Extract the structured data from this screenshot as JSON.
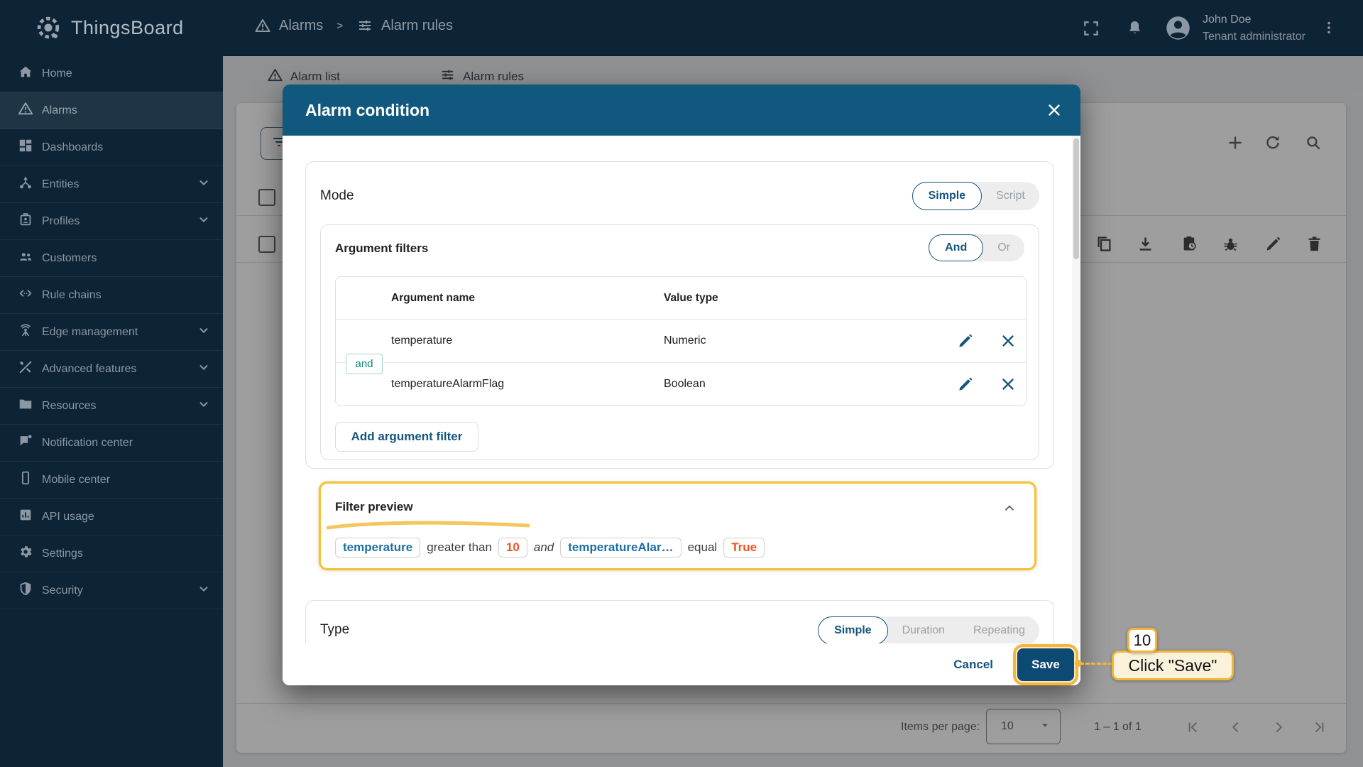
{
  "header": {
    "app_title": "ThingsBoard",
    "breadcrumb": {
      "section": "Alarms",
      "separator": ">",
      "page": "Alarm rules"
    },
    "user": {
      "name": "John Doe",
      "role": "Tenant administrator"
    }
  },
  "sidebar": {
    "items": [
      {
        "label": "Home",
        "icon": "home-icon",
        "expandable": false,
        "active": false
      },
      {
        "label": "Alarms",
        "icon": "warning-icon",
        "expandable": false,
        "active": true
      },
      {
        "label": "Dashboards",
        "icon": "dashboards-icon",
        "expandable": false,
        "active": false
      },
      {
        "label": "Entities",
        "icon": "entities-icon",
        "expandable": true,
        "active": false
      },
      {
        "label": "Profiles",
        "icon": "profiles-icon",
        "expandable": true,
        "active": false
      },
      {
        "label": "Customers",
        "icon": "customers-icon",
        "expandable": false,
        "active": false
      },
      {
        "label": "Rule chains",
        "icon": "rule-chains-icon",
        "expandable": false,
        "active": false
      },
      {
        "label": "Edge management",
        "icon": "edge-icon",
        "expandable": true,
        "active": false
      },
      {
        "label": "Advanced features",
        "icon": "tools-icon",
        "expandable": true,
        "active": false
      },
      {
        "label": "Resources",
        "icon": "folder-icon",
        "expandable": true,
        "active": false
      },
      {
        "label": "Notification center",
        "icon": "notification-icon",
        "expandable": false,
        "active": false
      },
      {
        "label": "Mobile center",
        "icon": "mobile-icon",
        "expandable": false,
        "active": false
      },
      {
        "label": "API usage",
        "icon": "api-usage-icon",
        "expandable": false,
        "active": false
      },
      {
        "label": "Settings",
        "icon": "gear-icon",
        "expandable": false,
        "active": false
      },
      {
        "label": "Security",
        "icon": "shield-icon",
        "expandable": true,
        "active": false
      }
    ]
  },
  "background": {
    "tabs": [
      {
        "label": "Alarm list"
      },
      {
        "label": "Alarm rules"
      }
    ],
    "toolbar_icons": [
      "filter",
      "add",
      "refresh",
      "search"
    ],
    "row_action_icons": [
      "copy",
      "download",
      "events",
      "debug",
      "edit",
      "delete"
    ],
    "pagination": {
      "items_per_page_label": "Items per page:",
      "items_per_page_value": "10",
      "range_label": "1 – 1 of 1"
    }
  },
  "modal": {
    "title": "Alarm condition",
    "mode": {
      "label": "Mode",
      "options": [
        "Simple",
        "Script"
      ],
      "selected": "Simple"
    },
    "argument_filters": {
      "title": "Argument filters",
      "operator_options": [
        "And",
        "Or"
      ],
      "operator_selected": "And",
      "table": {
        "columns": [
          "Argument name",
          "Value type"
        ],
        "rows": [
          {
            "argument_name": "temperature",
            "value_type": "Numeric"
          },
          {
            "argument_name": "temperatureAlarmFlag",
            "value_type": "Boolean"
          }
        ],
        "row_join_label": "and"
      },
      "add_button_label": "Add argument filter"
    },
    "filter_preview": {
      "title": "Filter preview",
      "expression": [
        {
          "type": "chip-blue",
          "text": "temperature"
        },
        {
          "type": "text",
          "text": "greater than"
        },
        {
          "type": "chip-orange",
          "text": "10"
        },
        {
          "type": "italic",
          "text": "and"
        },
        {
          "type": "chip-blue",
          "text": "temperatureAlar…"
        },
        {
          "type": "text",
          "text": "equal"
        },
        {
          "type": "chip-orange",
          "text": "True"
        }
      ]
    },
    "type_section": {
      "label": "Type",
      "options": [
        "Simple",
        "Duration",
        "Repeating"
      ],
      "selected": "Simple"
    },
    "footer": {
      "cancel_label": "Cancel",
      "save_label": "Save"
    }
  },
  "annotation": {
    "step_number": "10",
    "instruction": "Click \"Save\""
  },
  "colors": {
    "sidebar_navy": "#0d2336",
    "modal_header_blue": "#11587e",
    "primary_blue": "#14557c",
    "save_button_blue": "#0d4a73",
    "chip_blue": "#1b6fa3",
    "accent_orange": "#f4511e",
    "join_teal": "#00897b",
    "annotation_yellow": "#f2b63c"
  }
}
